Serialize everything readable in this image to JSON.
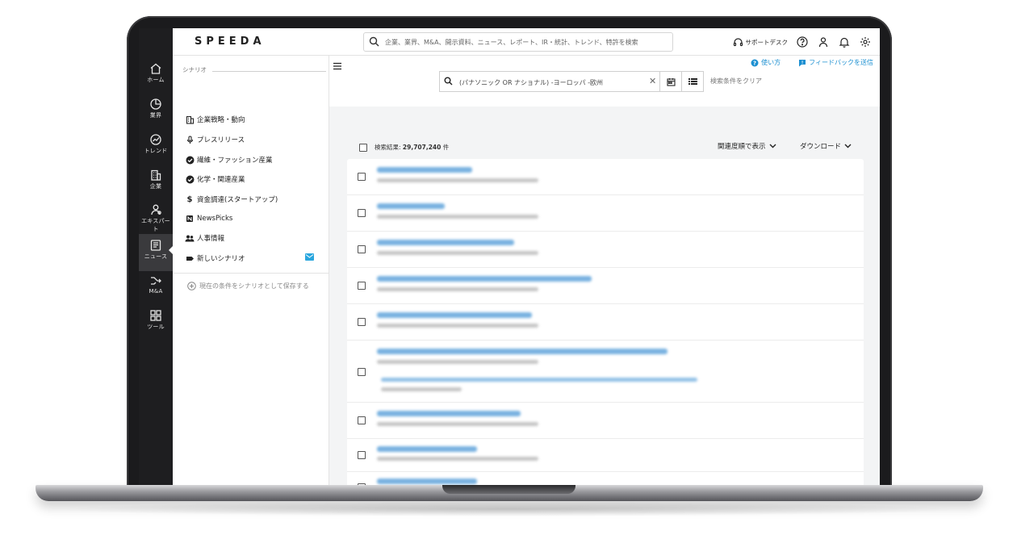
{
  "app": {
    "logo": "SPEEDA"
  },
  "header": {
    "search_placeholder": "企業、業界、M&A、開示資料、ニュース、レポート、IR・統計、トレンド、特許を検索",
    "support_label": "サポートデスク",
    "icons": [
      "headset-icon",
      "help-icon",
      "user-icon",
      "bell-icon",
      "gear-icon"
    ]
  },
  "rail": [
    {
      "label": "ホーム",
      "icon": "home-icon"
    },
    {
      "label": "業界",
      "icon": "pie-chart-icon"
    },
    {
      "label": "トレンド",
      "icon": "trend-icon"
    },
    {
      "label": "企業",
      "icon": "building-icon"
    },
    {
      "label": "エキスパート",
      "icon": "expert-icon"
    },
    {
      "label": "ニュース",
      "icon": "news-icon",
      "active": true
    },
    {
      "label": "M&A",
      "icon": "merge-icon"
    },
    {
      "label": "ツール",
      "icon": "tools-icon"
    }
  ],
  "scenario": {
    "heading": "シナリオ",
    "items": [
      {
        "label": "企業戦略・動向",
        "icon": "building-icon"
      },
      {
        "label": "プレスリリース",
        "icon": "microphone-icon"
      },
      {
        "label": "繊維・ファッション産業",
        "icon": "check-circle-icon"
      },
      {
        "label": "化学・関連産業",
        "icon": "check-circle-icon"
      },
      {
        "label": "資金調達(スタートアップ)",
        "icon": "dollar-icon"
      },
      {
        "label": "NewsPicks",
        "icon": "newspicks-icon"
      },
      {
        "label": "人事情報",
        "icon": "people-icon"
      },
      {
        "label": "新しいシナリオ",
        "icon": "tag-icon"
      }
    ],
    "save_label": "現在の条件をシナリオとして保存する"
  },
  "main": {
    "help_link": "使い方",
    "feedback_link": "フィードバックを送信",
    "keyword_value": "(パナソニック OR ナショナル) -ヨーロッパ -欧州",
    "clear_conditions": "検索条件をクリア",
    "results_label": "検索結果:",
    "results_count": "29,707,240",
    "results_unit": "件",
    "sort_label": "関連度順で表示",
    "download_label": "ダウンロード"
  },
  "colors": {
    "link_blue": "#1b8fd1",
    "rail_bg": "#1e1e20",
    "content_bg": "#f3f4f5"
  }
}
